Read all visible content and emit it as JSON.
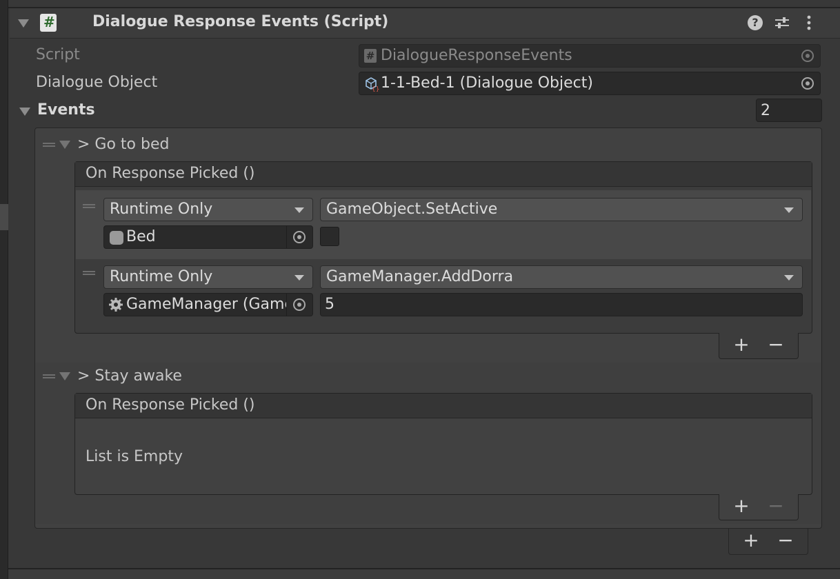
{
  "component": {
    "title": "Dialogue Response Events (Script)",
    "script_label": "Script",
    "script_value": "DialogueResponseEvents",
    "dialogue_object_label": "Dialogue Object",
    "dialogue_object_value": "1-1-Bed-1 (Dialogue Object)",
    "events_label": "Events",
    "events_count": "2"
  },
  "events": [
    {
      "name": "> Go to bed",
      "unity_event_header": "On Response Picked ()",
      "listeners": [
        {
          "mode": "Runtime Only",
          "function": "GameObject.SetActive",
          "target": "Bed"
        },
        {
          "mode": "Runtime Only",
          "function": "GameManager.AddDorra",
          "target": "GameManager (Game",
          "argument": "5"
        }
      ]
    },
    {
      "name": "> Stay awake",
      "unity_event_header": "On Response Picked ()",
      "empty_text": "List is Empty"
    }
  ],
  "controls": {
    "plus": "+",
    "minus": "−"
  },
  "icons": {
    "script": "hash-script-icon",
    "help": "help-icon",
    "presets": "presets-icon",
    "menu": "kebab-menu-icon",
    "picker": "object-picker-icon",
    "gameobject": "gameobject-cube-icon",
    "gear": "gear-icon",
    "dialogue_asset": "dialogue-object-icon"
  },
  "colors": {
    "background": "#383838",
    "field": "#2a2a2a",
    "dropdown": "#515151",
    "text": "#d2d2d2",
    "script_icon": "#4a8a4a"
  }
}
